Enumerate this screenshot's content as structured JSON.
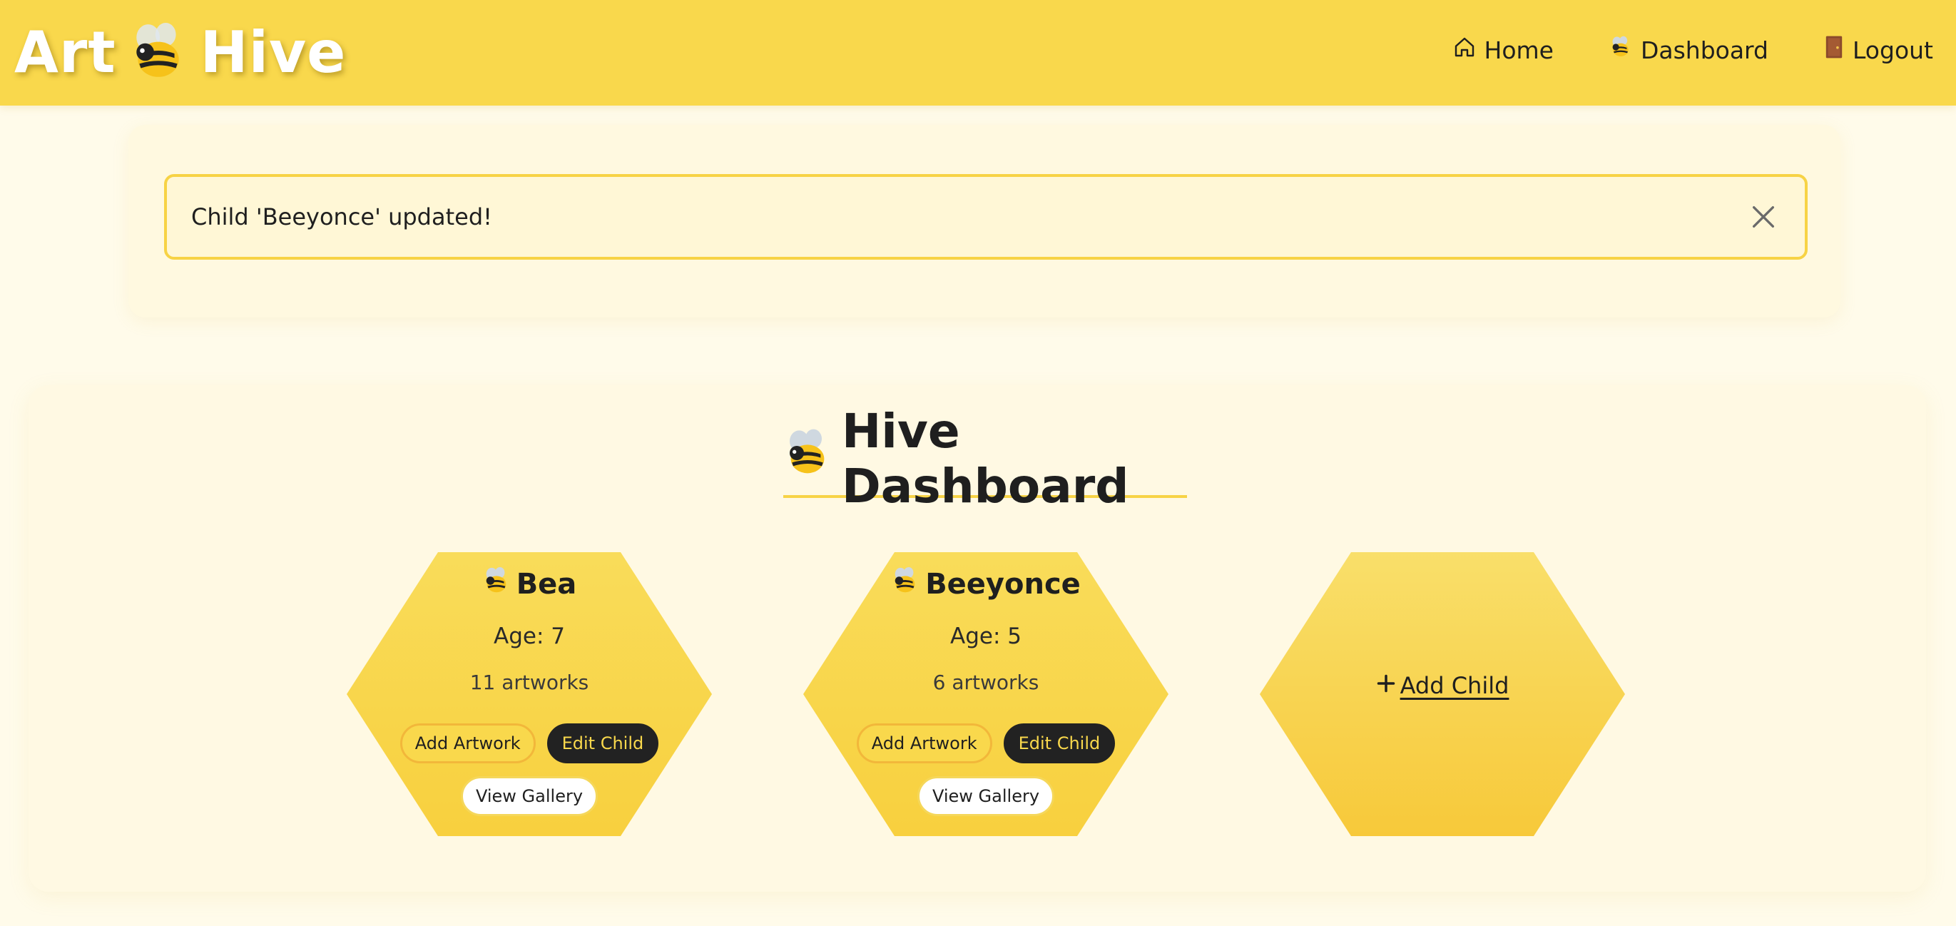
{
  "app": {
    "brand_left": "Art",
    "brand_right": "Hive"
  },
  "nav": {
    "items": [
      {
        "label": "Home",
        "icon": "home-icon"
      },
      {
        "label": "Dashboard",
        "icon": "bee-icon"
      },
      {
        "label": "Logout",
        "icon": "door-icon"
      }
    ]
  },
  "alert": {
    "message": "Child 'Beeyonce' updated!",
    "close_icon": "close-icon"
  },
  "dashboard": {
    "title": "Hive Dashboard",
    "children": [
      {
        "name": "Bea",
        "age": "Age: 7",
        "artworks": "11 artworks",
        "add_artwork_label": "Add Artwork",
        "edit_child_label": "Edit Child",
        "view_gallery_label": "View Gallery"
      },
      {
        "name": "Beeyonce",
        "age": "Age: 5",
        "artworks": "6 artworks",
        "add_artwork_label": "Add Artwork",
        "edit_child_label": "Edit Child",
        "view_gallery_label": "View Gallery"
      }
    ],
    "add_child_label": "Add Child"
  },
  "colors": {
    "header": "#f9d84c",
    "page_background": "#fffbea",
    "accent_border": "#f7d345",
    "dark_button": "#222222",
    "dark_button_text": "#f9d84c"
  }
}
